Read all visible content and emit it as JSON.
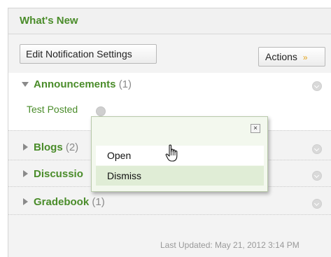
{
  "header": {
    "title": "What's New"
  },
  "toolbar": {
    "edit_label": "Edit Notification Settings",
    "actions_label": "Actions",
    "actions_icon": "double-chevron-down-icon"
  },
  "sections": [
    {
      "title": "Announcements",
      "count": "(1)",
      "expanded": true,
      "items": [
        {
          "label": "Test Posted"
        }
      ]
    },
    {
      "title": "Blogs",
      "count": "(2)",
      "expanded": false
    },
    {
      "title": "Discussio",
      "count": "",
      "expanded": false
    },
    {
      "title": "Gradebook",
      "count": "(1)",
      "expanded": false
    }
  ],
  "popup": {
    "close_label": "×",
    "items": [
      {
        "label": "Open"
      },
      {
        "label": "Dismiss"
      }
    ]
  },
  "footer": {
    "last_updated": "Last Updated: May 21, 2012 3:14 PM"
  },
  "colors": {
    "accent_green": "#4a8c2a",
    "chevron_orange": "#e2a41e"
  }
}
